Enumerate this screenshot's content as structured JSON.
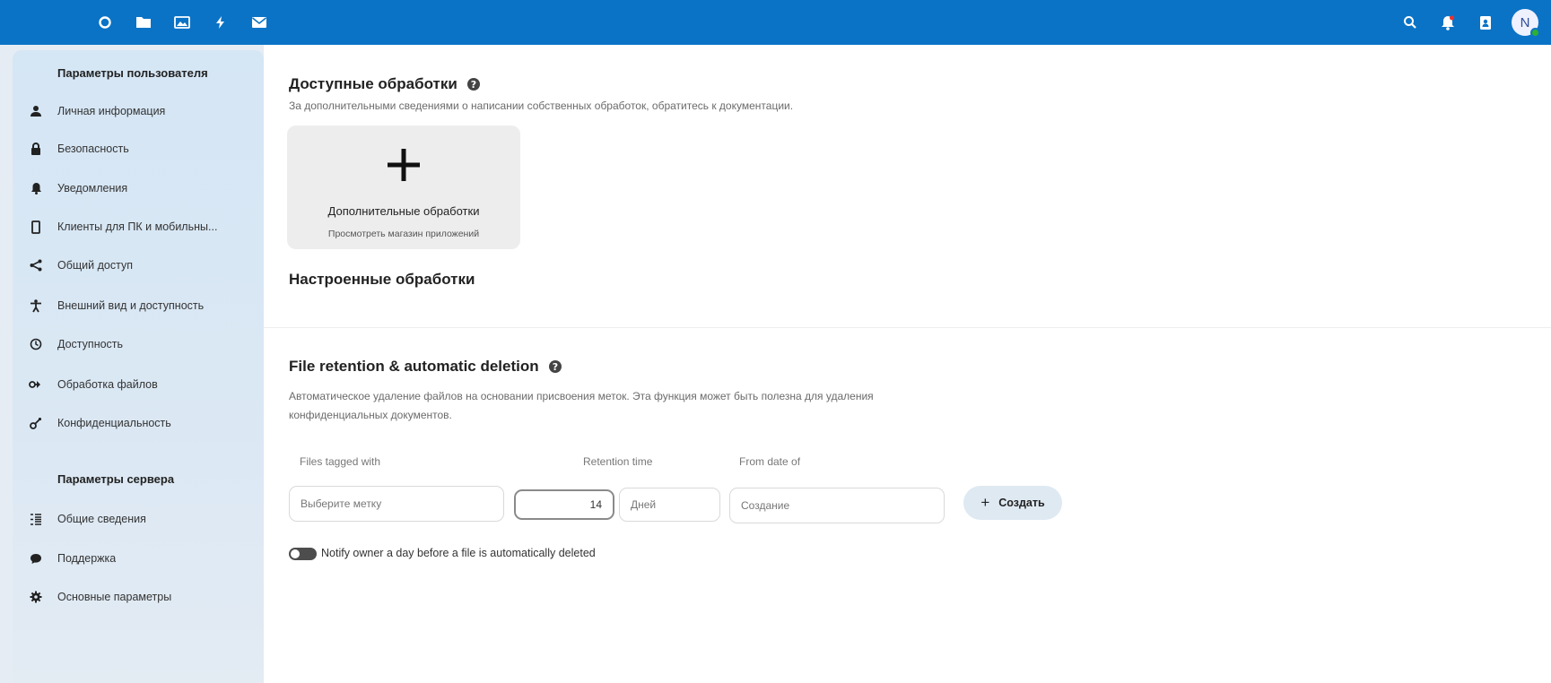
{
  "header": {
    "app_icons": [
      "dashboard-icon",
      "files-icon",
      "photos-icon",
      "activity-icon",
      "mail-icon"
    ],
    "right_icons": [
      "search-icon",
      "notifications-icon",
      "contacts-icon"
    ],
    "avatar_initial": "N"
  },
  "sidebar": {
    "personal_heading": "Параметры пользователя",
    "personal_items": [
      {
        "label": "Личная информация",
        "icon": "user-icon"
      },
      {
        "label": "Безопасность",
        "icon": "lock-icon"
      },
      {
        "label": "Уведомления",
        "icon": "bell-icon"
      },
      {
        "label": "Клиенты для ПК и мобильны...",
        "icon": "phone-icon"
      },
      {
        "label": "Общий доступ",
        "icon": "share-icon"
      },
      {
        "label": "Внешний вид и доступность",
        "icon": "accessibility-icon"
      },
      {
        "label": "Доступность",
        "icon": "clock-icon"
      },
      {
        "label": "Обработка файлов",
        "icon": "workflow-icon"
      },
      {
        "label": "Конфиденциальность",
        "icon": "key-icon"
      }
    ],
    "server_heading": "Параметры сервера",
    "server_items": [
      {
        "label": "Общие сведения",
        "icon": "overview-icon"
      },
      {
        "label": "Поддержка",
        "icon": "support-icon"
      },
      {
        "label": "Основные параметры",
        "icon": "settings-icon"
      }
    ]
  },
  "main": {
    "available_title": "Доступные обработки",
    "available_desc": "За дополнительными сведениями о написании собственных обработок, обратитесь к документации.",
    "card_title": "Дополнительные обработки",
    "card_subtitle": "Просмотреть магазин приложений",
    "configured_title": "Настроенные обработки",
    "retention_title": "File retention & automatic deletion",
    "retention_desc_line1": "Автоматическое удаление файлов на основании присвоения меток. Эта функция может быть полезна для удаления",
    "retention_desc_line2": "конфиденциальных документов.",
    "col_tagged": "Files tagged with",
    "col_retention": "Retention time",
    "col_from": "From date of",
    "tag_placeholder": "Выберите метку",
    "retention_value": "14",
    "retention_unit": "Дней",
    "from_value": "Создание",
    "create_label": "Создать",
    "notify_label": "Notify owner a day before a file is automatically deleted",
    "notify_enabled": false
  }
}
